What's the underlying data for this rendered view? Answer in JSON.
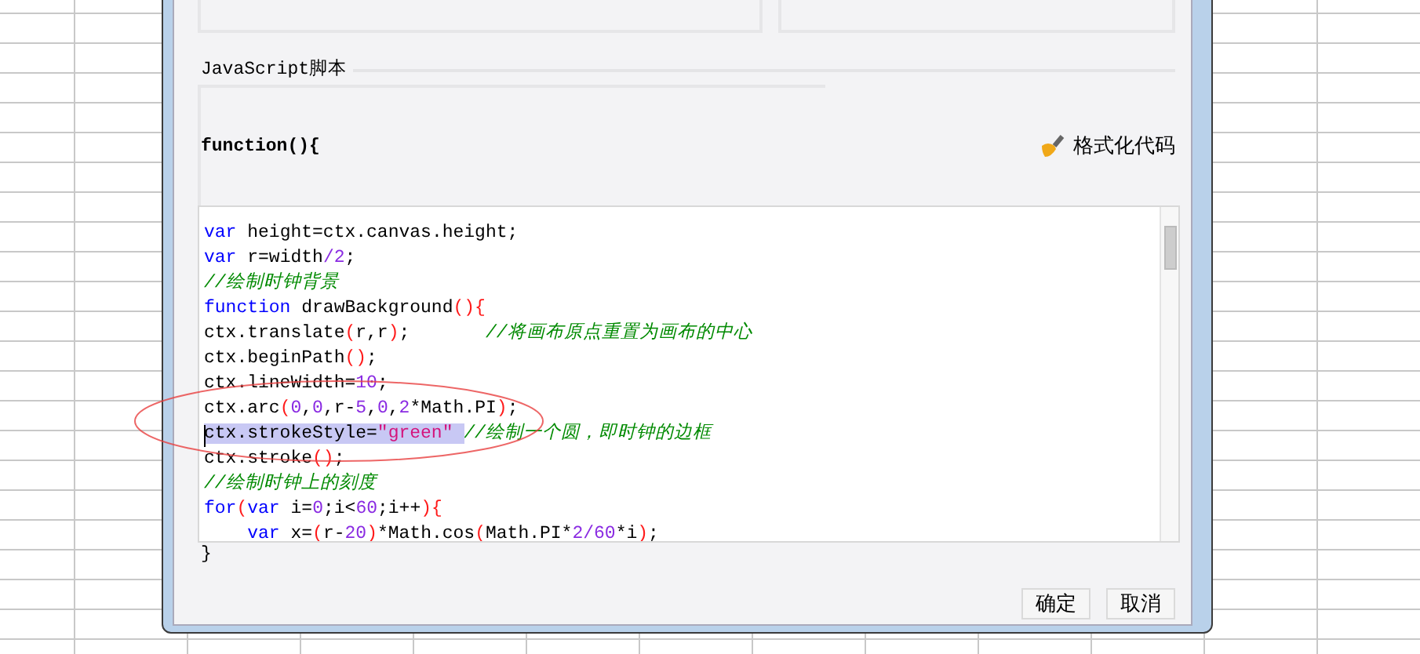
{
  "script_section": {
    "label": "JavaScript脚本",
    "header": "function(){",
    "format_button": "格式化代码"
  },
  "code_lines": [
    {
      "selected": false,
      "tokens": [
        {
          "kind": "keyword",
          "text": "var"
        },
        {
          "kind": "plain",
          "text": " height=ctx.canvas.height;"
        }
      ]
    },
    {
      "selected": false,
      "tokens": [
        {
          "kind": "keyword",
          "text": "var"
        },
        {
          "kind": "plain",
          "text": " r=width"
        },
        {
          "kind": "number",
          "text": "/2"
        },
        {
          "kind": "plain",
          "text": ";"
        }
      ]
    },
    {
      "selected": false,
      "tokens": [
        {
          "kind": "comment",
          "text": "//绘制时钟背景"
        }
      ]
    },
    {
      "selected": false,
      "tokens": [
        {
          "kind": "keyword",
          "text": "function"
        },
        {
          "kind": "plain",
          "text": " drawBackground"
        },
        {
          "kind": "paren",
          "text": "(){"
        }
      ]
    },
    {
      "selected": false,
      "tokens": [
        {
          "kind": "plain",
          "text": "ctx.translate"
        },
        {
          "kind": "paren",
          "text": "("
        },
        {
          "kind": "plain",
          "text": "r,r"
        },
        {
          "kind": "paren",
          "text": ")"
        },
        {
          "kind": "plain",
          "text": ";       "
        },
        {
          "kind": "comment",
          "text": "//将画布原点重置为画布的中心"
        }
      ]
    },
    {
      "selected": false,
      "tokens": [
        {
          "kind": "plain",
          "text": "ctx.beginPath"
        },
        {
          "kind": "paren",
          "text": "()"
        },
        {
          "kind": "plain",
          "text": ";"
        }
      ]
    },
    {
      "selected": false,
      "tokens": [
        {
          "kind": "plain",
          "text": "ctx.lineWidth="
        },
        {
          "kind": "number",
          "text": "10"
        },
        {
          "kind": "plain",
          "text": ";"
        }
      ]
    },
    {
      "selected": false,
      "tokens": [
        {
          "kind": "plain",
          "text": "ctx.arc"
        },
        {
          "kind": "paren",
          "text": "("
        },
        {
          "kind": "number",
          "text": "0"
        },
        {
          "kind": "plain",
          "text": ","
        },
        {
          "kind": "number",
          "text": "0"
        },
        {
          "kind": "plain",
          "text": ",r-"
        },
        {
          "kind": "number",
          "text": "5"
        },
        {
          "kind": "plain",
          "text": ","
        },
        {
          "kind": "number",
          "text": "0"
        },
        {
          "kind": "plain",
          "text": ","
        },
        {
          "kind": "number",
          "text": "2"
        },
        {
          "kind": "plain",
          "text": "*Math.PI"
        },
        {
          "kind": "paren",
          "text": ")"
        },
        {
          "kind": "plain",
          "text": ";"
        }
      ]
    },
    {
      "selected": true,
      "tokens": [
        {
          "kind": "plain",
          "text": "ctx.strokeStyle="
        },
        {
          "kind": "string",
          "text": "\"green\" "
        },
        {
          "kind": "comment",
          "text": "//绘制一个圆，即时钟的边框"
        }
      ]
    },
    {
      "selected": false,
      "tokens": [
        {
          "kind": "plain",
          "text": "ctx.stroke"
        },
        {
          "kind": "paren",
          "text": "()"
        },
        {
          "kind": "plain",
          "text": ";"
        }
      ]
    },
    {
      "selected": false,
      "tokens": [
        {
          "kind": "comment",
          "text": "//绘制时钟上的刻度"
        }
      ]
    },
    {
      "selected": false,
      "tokens": [
        {
          "kind": "keyword",
          "text": "for"
        },
        {
          "kind": "paren",
          "text": "("
        },
        {
          "kind": "keyword",
          "text": "var"
        },
        {
          "kind": "plain",
          "text": " i="
        },
        {
          "kind": "number",
          "text": "0"
        },
        {
          "kind": "plain",
          "text": ";i<"
        },
        {
          "kind": "number",
          "text": "60"
        },
        {
          "kind": "plain",
          "text": ";i++"
        },
        {
          "kind": "paren",
          "text": "){"
        }
      ]
    },
    {
      "selected": false,
      "tokens": [
        {
          "kind": "keyword",
          "text": "    var"
        },
        {
          "kind": "plain",
          "text": " x="
        },
        {
          "kind": "paren",
          "text": "("
        },
        {
          "kind": "plain",
          "text": "r-"
        },
        {
          "kind": "number",
          "text": "20"
        },
        {
          "kind": "paren",
          "text": ")"
        },
        {
          "kind": "plain",
          "text": "*Math.cos"
        },
        {
          "kind": "paren",
          "text": "("
        },
        {
          "kind": "plain",
          "text": "Math.PI*"
        },
        {
          "kind": "number",
          "text": "2/60"
        },
        {
          "kind": "plain",
          "text": "*i"
        },
        {
          "kind": "paren",
          "text": ")"
        },
        {
          "kind": "plain",
          "text": ";"
        }
      ]
    }
  ],
  "footer": "}",
  "buttons": [
    "确定",
    "取消"
  ]
}
